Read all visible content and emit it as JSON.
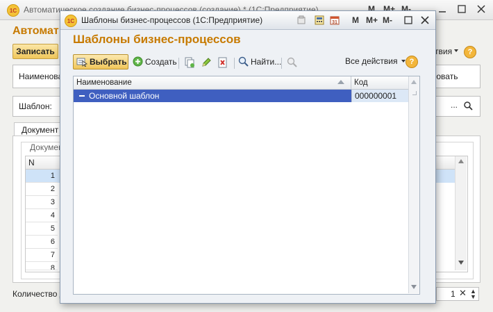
{
  "background_window": {
    "title": "Автоматическое создание бизнес-процессов (создание) * (1С:Предприятие)",
    "heading": "Автомат",
    "save_button": "Записать",
    "name_label": "Наименова",
    "use_label": "зовать",
    "template_label": "Шаблон:",
    "all_actions": "твия",
    "tab_label": "Документ",
    "group_label": "Докумен",
    "grid_header_n": "N",
    "row_numbers": [
      "1",
      "2",
      "3",
      "4",
      "5",
      "6",
      "7",
      "8"
    ],
    "count_label": "Количество д",
    "count_value": "1",
    "toolbar_icons": [
      "M",
      "M+",
      "M-"
    ]
  },
  "dialog": {
    "title": "Шаблоны бизнес-процессов  (1С:Предприятие)",
    "heading": "Шаблоны бизнес-процессов",
    "toolbar": {
      "select": "Выбрать",
      "create": "Создать",
      "find": "Найти...",
      "all_actions": "Все действия"
    },
    "columns": {
      "name": "Наименование",
      "code": "Код"
    },
    "rows": [
      {
        "name": "Основной шаблон",
        "code": "000000001"
      }
    ],
    "title_buttons": [
      "M",
      "M+",
      "M-"
    ]
  },
  "colors": {
    "accent_orange": "#c77a00",
    "selection_blue": "#3f5fc0",
    "code_cell": "#dce8f6",
    "select_button": "#f0c65a"
  }
}
